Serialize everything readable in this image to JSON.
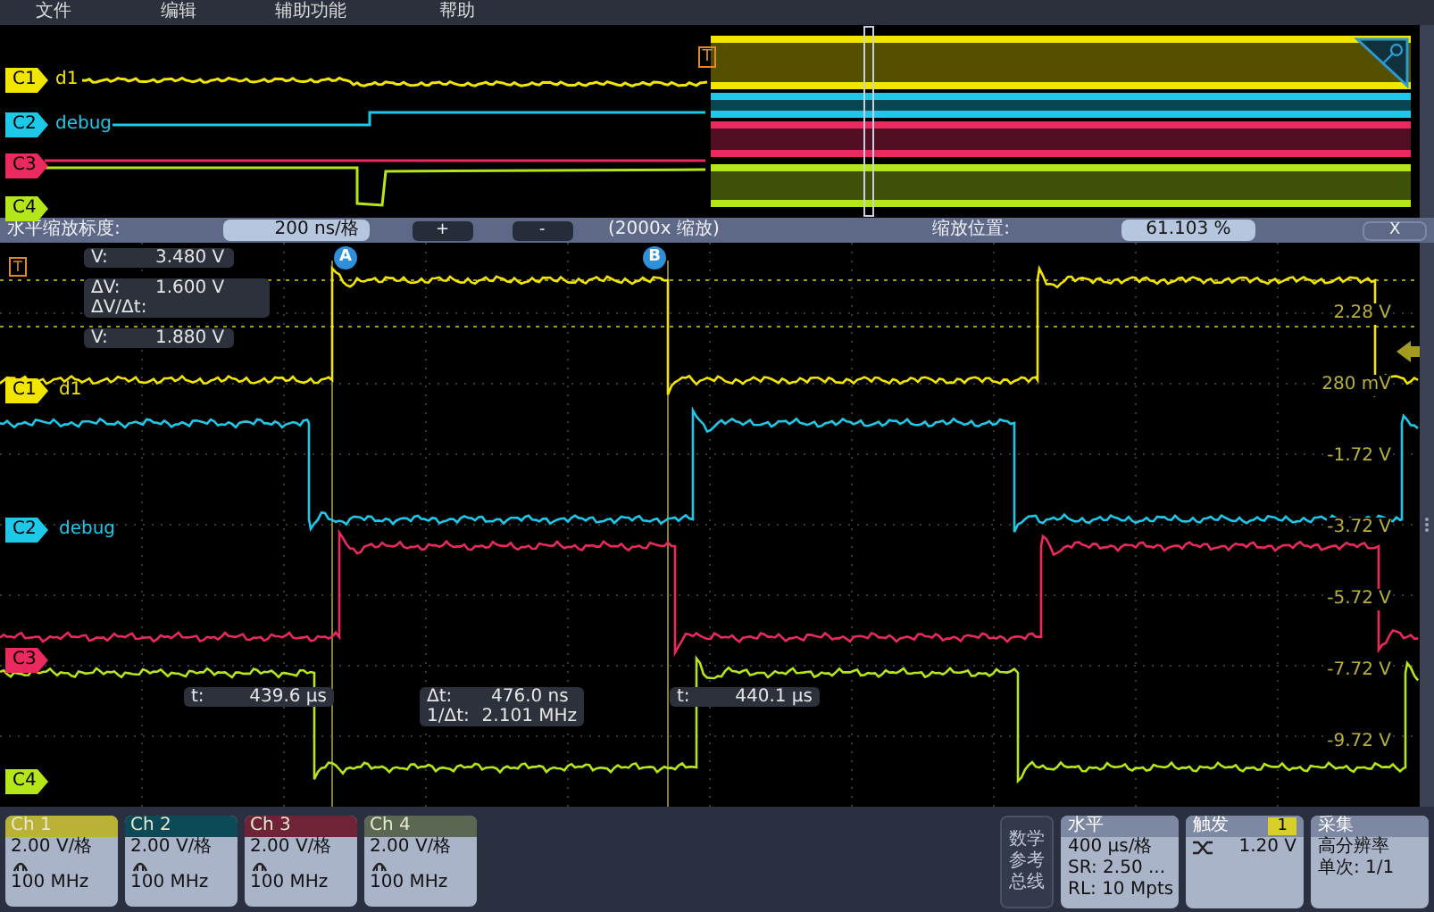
{
  "menu": [
    "文件",
    "编辑",
    "辅助功能",
    "帮助"
  ],
  "overview": {
    "trigger_marker": "T",
    "channels": [
      {
        "badge": "C1",
        "label": "d1",
        "color": "#f2e500"
      },
      {
        "badge": "C2",
        "label": "debug",
        "color": "#1ec8e8"
      },
      {
        "badge": "C3",
        "color": "#ea2a5e"
      },
      {
        "badge": "C4",
        "color": "#b5e61a"
      }
    ]
  },
  "zoom_bar": {
    "scale_label": "水平缩放标度:",
    "scale_value": "200 ns/格",
    "plus": "+",
    "minus": "-",
    "factor": "(2000x 缩放)",
    "position_label": "缩放位置:",
    "position_value": "61.103 %",
    "close": "X"
  },
  "main": {
    "trigger_marker": "T",
    "cursor_a": "A",
    "cursor_b": "B",
    "channels": [
      {
        "badge": "C1",
        "label": "d1",
        "color": "#f2e500"
      },
      {
        "badge": "C2",
        "label": "debug",
        "color": "#1ec8e8"
      },
      {
        "badge": "C3",
        "color": "#ea2a5e"
      },
      {
        "badge": "C4",
        "color": "#b5e61a"
      }
    ],
    "readouts": [
      {
        "lines": [
          {
            "label": "V:",
            "value": "3.480 V"
          }
        ]
      },
      {
        "lines": [
          {
            "label": "ΔV:",
            "value": "1.600 V"
          },
          {
            "label": "ΔV/Δt:"
          }
        ]
      },
      {
        "lines": [
          {
            "label": "V:",
            "value": "1.880 V"
          }
        ]
      },
      {
        "lines": [
          {
            "label": "t:",
            "value": "439.6 µs"
          }
        ]
      },
      {
        "lines": [
          {
            "label": "Δt:",
            "value": "476.0 ns"
          },
          {
            "label": "1/Δt:",
            "value": "2.101 MHz"
          }
        ]
      },
      {
        "lines": [
          {
            "label": "t:",
            "value": "440.1 µs"
          }
        ]
      }
    ],
    "scale_labels": [
      "2.28 V",
      "280 mV",
      "-1.72 V",
      "-3.72 V",
      "-5.72 V",
      "-7.72 V",
      "-9.72 V"
    ]
  },
  "channel_cards": [
    {
      "title": "Ch 1",
      "color": "#b9b236",
      "scale": "2.00 V/格",
      "bandwidth": "100 MHz"
    },
    {
      "title": "Ch 2",
      "color": "#0d4a58",
      "scale": "2.00 V/格",
      "bandwidth": "100 MHz"
    },
    {
      "title": "Ch 3",
      "color": "#6e2436",
      "scale": "2.00 V/格",
      "bandwidth": "100 MHz"
    },
    {
      "title": "Ch 4",
      "color": "#5b6752",
      "scale": "2.00 V/格",
      "bandwidth": "100 MHz"
    }
  ],
  "math_button": [
    "数学",
    "参考",
    "总线"
  ],
  "horizontal": {
    "title": "水平",
    "lines": [
      "400 µs/格",
      "SR: 2.50 ...",
      "RL: 10 Mpts"
    ]
  },
  "trigger": {
    "title": "触发",
    "source": "1",
    "level": "1.20 V"
  },
  "acquisition": {
    "title": "采集",
    "lines": [
      "高分辨率",
      "单次: 1/1"
    ]
  }
}
